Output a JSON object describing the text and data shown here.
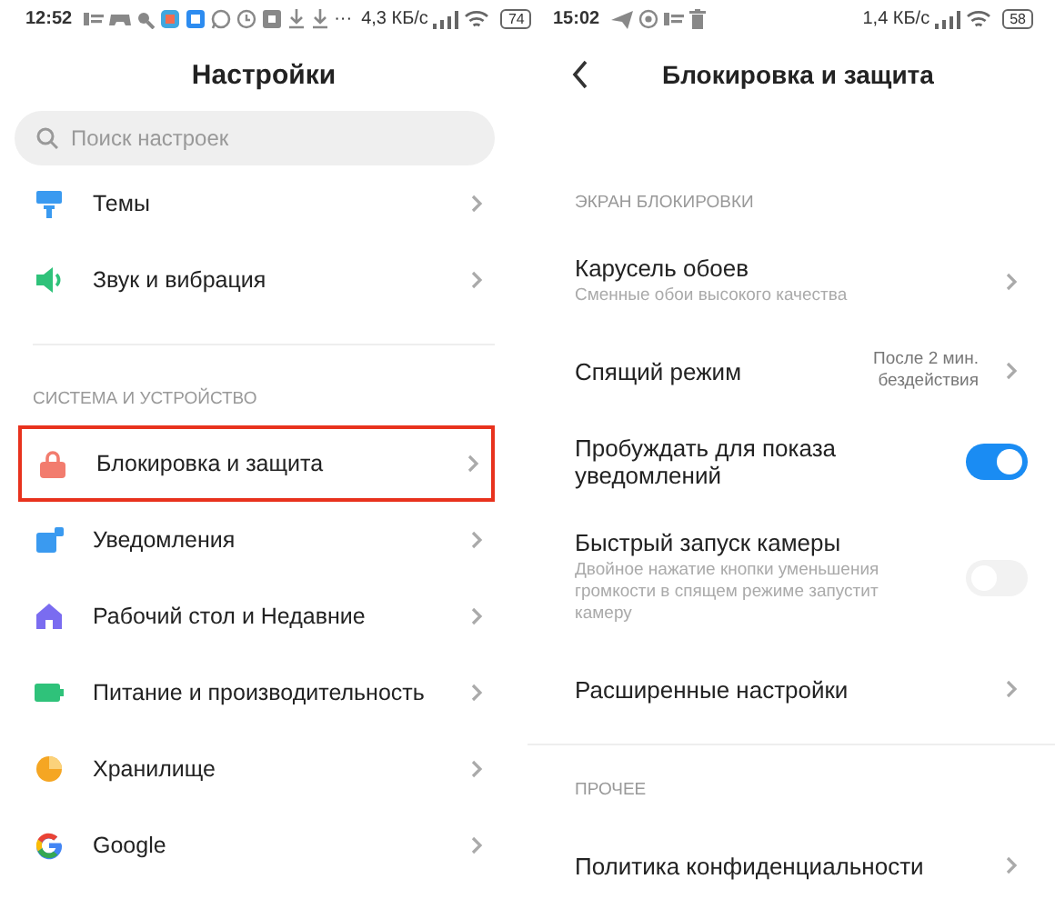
{
  "left": {
    "status_bar": {
      "time": "12:52",
      "overflow": "···",
      "speed": "4,3 КБ/с",
      "battery": "74"
    },
    "title": "Настройки",
    "search": {
      "placeholder": "Поиск настроек"
    },
    "groups": [
      {
        "items": [
          {
            "label": "Темы",
            "highlighted": false
          },
          {
            "label": "Звук и вибрация",
            "highlighted": false
          }
        ]
      },
      {
        "header": "СИСТЕМА И УСТРОЙСТВО",
        "items": [
          {
            "label": "Блокировка и защита",
            "highlighted": true
          },
          {
            "label": "Уведомления",
            "highlighted": false
          },
          {
            "label": "Рабочий стол и Недавние",
            "highlighted": false
          },
          {
            "label": "Питание и производительность",
            "highlighted": false
          },
          {
            "label": "Хранилище",
            "highlighted": false
          },
          {
            "label": "Google",
            "highlighted": false
          }
        ]
      }
    ]
  },
  "right": {
    "status_bar": {
      "time": "15:02",
      "speed": "1,4 КБ/с",
      "battery": "58"
    },
    "title": "Блокировка и защита",
    "sections": [
      {
        "header": "ЭКРАН БЛОКИРОВКИ",
        "items": [
          {
            "kind": "link",
            "title": "Карусель обоев",
            "subtitle": "Сменные обои высокого качества"
          },
          {
            "kind": "link",
            "title": "Спящий режим",
            "value": "После 2 мин. бездействия"
          },
          {
            "kind": "toggle",
            "title": "Пробуждать для показа уведомлений",
            "on": true
          },
          {
            "kind": "toggle",
            "title": "Быстрый запуск камеры",
            "subtitle": "Двойное нажатие кнопки уменьшения громкости в спящем режиме запустит камеру",
            "on": false
          },
          {
            "kind": "link",
            "title": "Расширенные настройки"
          }
        ]
      },
      {
        "header": "ПРОЧЕЕ",
        "items": [
          {
            "kind": "link",
            "title": "Политика конфиденциальности"
          }
        ]
      }
    ]
  }
}
